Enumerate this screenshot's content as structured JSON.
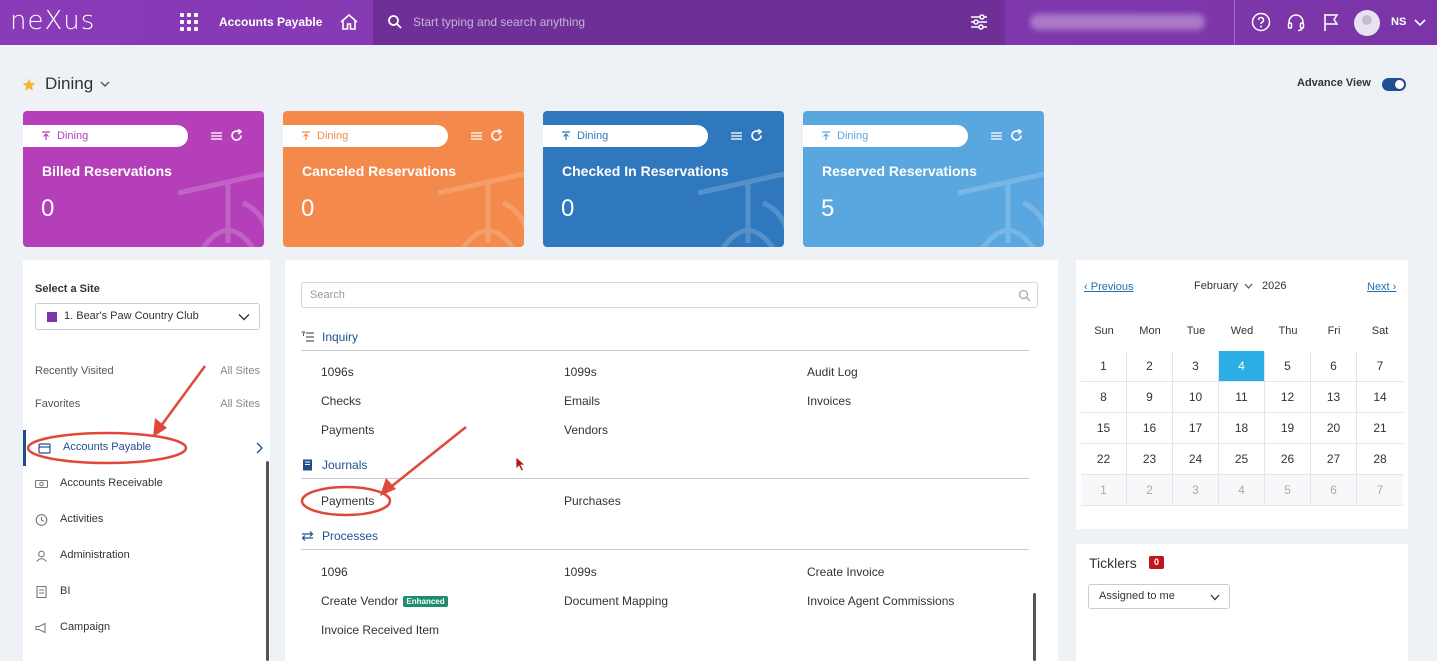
{
  "topbar": {
    "logo": "neXus",
    "module": "Accounts Payable",
    "search_placeholder": "Start typing and search anything",
    "user_initials": "NS"
  },
  "page": {
    "title": "Dining",
    "advance_view_label": "Advance View"
  },
  "kpis": [
    {
      "tag": "Dining",
      "label": "Billed Reservations",
      "value": "0",
      "color": "#b43fb8"
    },
    {
      "tag": "Dining",
      "label": "Canceled Reservations",
      "value": "0",
      "color": "#f3894a"
    },
    {
      "tag": "Dining",
      "label": "Checked In Reservations",
      "value": "0",
      "color": "#2f78be"
    },
    {
      "tag": "Dining",
      "label": "Reserved Reservations",
      "value": "5",
      "color": "#5aa7df"
    }
  ],
  "sidebar": {
    "site_label": "Select a Site",
    "site_value": "1. Bear's Paw Country Club",
    "recently_visited": "Recently Visited",
    "favorites": "Favorites",
    "all_sites": "All Sites",
    "items": [
      {
        "label": "Accounts Payable",
        "icon": "wallet-icon"
      },
      {
        "label": "Accounts Receivable",
        "icon": "cash-icon"
      },
      {
        "label": "Activities",
        "icon": "clock-icon"
      },
      {
        "label": "Administration",
        "icon": "user-icon"
      },
      {
        "label": "BI",
        "icon": "report-icon"
      },
      {
        "label": "Campaign",
        "icon": "megaphone-icon"
      }
    ]
  },
  "menu": {
    "search_placeholder": "Search",
    "sections": {
      "inquiry": {
        "title": "Inquiry",
        "links": [
          "1096s",
          "1099s",
          "Audit Log",
          "Checks",
          "Emails",
          "Invoices",
          "Payments",
          "Vendors"
        ]
      },
      "journals": {
        "title": "Journals",
        "links": [
          "Payments",
          "Purchases"
        ]
      },
      "processes": {
        "title": "Processes",
        "links": [
          "1096",
          "1099s",
          "Create Invoice",
          "Create Vendor",
          "Document Mapping",
          "Invoice Agent Commissions",
          "Invoice Received Item"
        ],
        "badge": "Enhanced"
      }
    }
  },
  "calendar": {
    "prev": "Previous",
    "next": "Next",
    "month": "February",
    "year": "2026",
    "weekdays": [
      "Sun",
      "Mon",
      "Tue",
      "Wed",
      "Thu",
      "Fri",
      "Sat"
    ],
    "weeks": [
      [
        "1",
        "2",
        "3",
        "4",
        "5",
        "6",
        "7"
      ],
      [
        "8",
        "9",
        "10",
        "11",
        "12",
        "13",
        "14"
      ],
      [
        "15",
        "16",
        "17",
        "18",
        "19",
        "20",
        "21"
      ],
      [
        "22",
        "23",
        "24",
        "25",
        "26",
        "27",
        "28"
      ],
      [
        "1",
        "2",
        "3",
        "4",
        "5",
        "6",
        "7"
      ]
    ],
    "today": "4"
  },
  "ticklers": {
    "title": "Ticklers",
    "count": "0",
    "filter": "Assigned to me"
  },
  "colors": {
    "brand": "#7b35a8",
    "link": "#1f4f8f",
    "annotation": "#e0483a"
  }
}
